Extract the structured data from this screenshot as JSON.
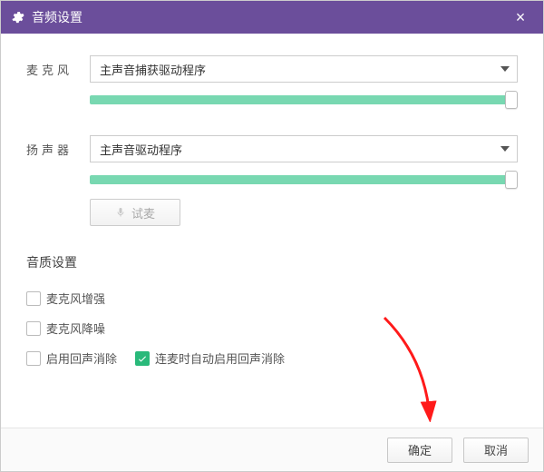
{
  "window": {
    "title": "音频设置"
  },
  "mic": {
    "label": "麦克风",
    "selected": "主声音捕获驱动程序",
    "volume_percent": 100
  },
  "speaker": {
    "label": "扬声器",
    "selected": "主声音驱动程序",
    "volume_percent": 100
  },
  "test": {
    "label": "试麦"
  },
  "quality": {
    "section_title": "音质设置",
    "mic_boost": {
      "label": "麦克风增强",
      "checked": false
    },
    "mic_noise": {
      "label": "麦克风降噪",
      "checked": false
    },
    "echo_cancel": {
      "label": "启用回声消除",
      "checked": false
    },
    "auto_echo": {
      "label": "连麦时自动启用回声消除",
      "checked": true
    }
  },
  "footer": {
    "ok": "确定",
    "cancel": "取消"
  },
  "icons": {
    "gear": "gear-icon",
    "close": "close-icon",
    "mic": "mic-icon",
    "caret": "caret-down-icon",
    "check": "check-icon"
  }
}
